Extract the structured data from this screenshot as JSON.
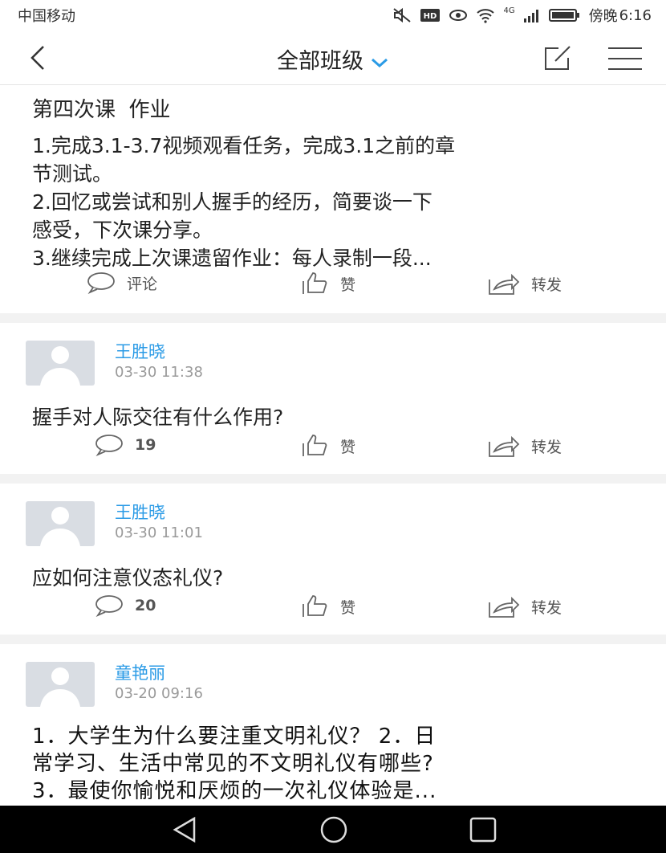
{
  "status": {
    "carrier": "中国移动",
    "network": "4G",
    "time_prefix": "傍晚",
    "time": "6:16"
  },
  "header": {
    "title": "全部班级",
    "icons": [
      "back-arrow-icon",
      "chevron-down-icon",
      "edit-icon",
      "menu-icon"
    ]
  },
  "assignment": {
    "title": "第四次课  作业",
    "lines": [
      "1.完成3.1-3.7视频观看任务，完成3.1之前的章",
      "节测试。",
      "2.回忆或尝试和别人握手的经历，简要谈一下",
      "感受，下次课分享。",
      "3.继续完成上次课遗留作业：每人录制一段..."
    ],
    "comment_label": "评论",
    "like_label": "赞",
    "share_label": "转发"
  },
  "posts": [
    {
      "author": "王胜晓",
      "time": "03-30 11:38",
      "text": "握手对人际交往有什么作用?",
      "comments": "19",
      "like_label": "赞",
      "share_label": "转发"
    },
    {
      "author": "王胜晓",
      "time": "03-30 11:01",
      "text": "应如何注意仪态礼仪?",
      "comments": "20",
      "like_label": "赞",
      "share_label": "转发"
    },
    {
      "author": "童艳丽",
      "time": "03-20 09:16",
      "lines": [
        "1．大学生为什么要注重文明礼仪？ 2．日",
        "常学习、生活中常见的不文明礼仪有哪些?",
        "3．最使你愉悦和厌烦的一次礼仪体验是..."
      ]
    }
  ],
  "colors": {
    "accent": "#2b9be6",
    "divider": "#f2f2f2",
    "navbar_bg": "#000000"
  }
}
